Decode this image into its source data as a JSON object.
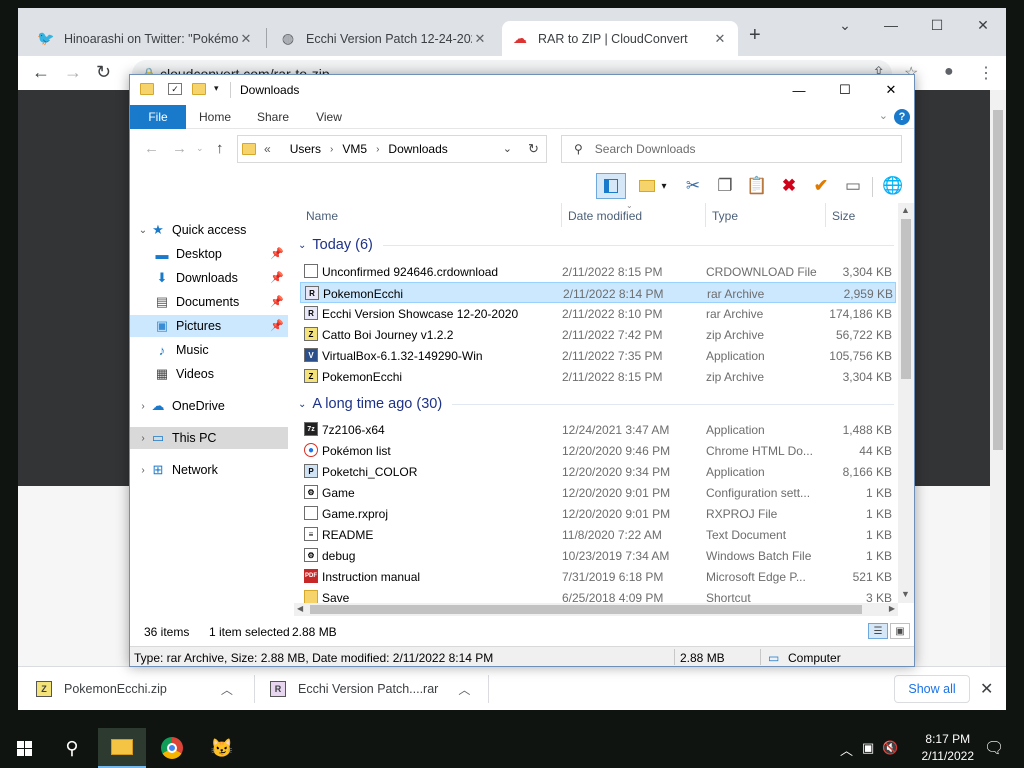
{
  "browser": {
    "tabs": [
      {
        "title": "Hinoarashi on Twitter: \"Pokémon",
        "favicon": "twitter-icon",
        "close": "✕"
      },
      {
        "title": "Ecchi Version Patch 12-24-2020",
        "favicon": "globe-icon",
        "close": "✕"
      },
      {
        "title": "RAR to ZIP | CloudConvert",
        "favicon": "cloudconvert-icon",
        "close": "✕"
      }
    ],
    "url": "cloudconvert.com/rar-to-zip",
    "downloads": [
      {
        "name": "PokemonEcchi.zip",
        "badge": "Z"
      },
      {
        "name": "Ecchi Version Patch....rar",
        "badge": "R"
      }
    ],
    "show_all": "Show all"
  },
  "explorer": {
    "title": "Downloads",
    "ribbon_tabs": [
      "File",
      "Home",
      "Share",
      "View"
    ],
    "breadcrumb": [
      "«",
      "Users",
      "VM5",
      "Downloads"
    ],
    "search_placeholder": "Search Downloads",
    "nav": [
      {
        "label": "Quick access",
        "icon": "star-icon",
        "pinned": false
      },
      {
        "label": "Desktop",
        "icon": "desktop-icon",
        "pinned": true
      },
      {
        "label": "Downloads",
        "icon": "download-arrow-icon",
        "pinned": true
      },
      {
        "label": "Documents",
        "icon": "document-icon",
        "pinned": true
      },
      {
        "label": "Pictures",
        "icon": "pictures-icon",
        "pinned": true
      },
      {
        "label": "Music",
        "icon": "music-note-icon",
        "pinned": false
      },
      {
        "label": "Videos",
        "icon": "video-icon",
        "pinned": false
      },
      {
        "label": "OneDrive",
        "icon": "cloud-icon",
        "pinned": false
      },
      {
        "label": "This PC",
        "icon": "computer-icon",
        "pinned": false
      },
      {
        "label": "Network",
        "icon": "network-icon",
        "pinned": false
      }
    ],
    "columns": [
      "Name",
      "Date modified",
      "Type",
      "Size"
    ],
    "groups": [
      {
        "label": "Today (6)",
        "rows": [
          {
            "name": "Unconfirmed 924646.crdownload",
            "date": "2/11/2022 8:15 PM",
            "type": "CRDOWNLOAD File",
            "size": "3,304 KB",
            "badge": ""
          },
          {
            "name": "PokemonEcchi",
            "date": "2/11/2022 8:14 PM",
            "type": "rar Archive",
            "size": "2,959 KB",
            "badge": "R"
          },
          {
            "name": "Ecchi Version Showcase 12-20-2020",
            "date": "2/11/2022 8:10 PM",
            "type": "rar Archive",
            "size": "174,186 KB",
            "badge": "R"
          },
          {
            "name": "Catto Boi Journey v1.2.2",
            "date": "2/11/2022 7:42 PM",
            "type": "zip Archive",
            "size": "56,722 KB",
            "badge": "Z"
          },
          {
            "name": "VirtualBox-6.1.32-149290-Win",
            "date": "2/11/2022 7:35 PM",
            "type": "Application",
            "size": "105,756 KB",
            "badge": "V"
          },
          {
            "name": "PokemonEcchi",
            "date": "2/11/2022 8:15 PM",
            "type": "zip Archive",
            "size": "3,304 KB",
            "badge": "Z"
          }
        ]
      },
      {
        "label": "A long time ago (30)",
        "rows": [
          {
            "name": "7z2106-x64",
            "date": "12/24/2021 3:47 AM",
            "type": "Application",
            "size": "1,488 KB",
            "badge": "7z"
          },
          {
            "name": "Pokémon list",
            "date": "12/20/2020 9:46 PM",
            "type": "Chrome HTML Do...",
            "size": "44 KB",
            "badge": "●"
          },
          {
            "name": "Poketchi_COLOR",
            "date": "12/20/2020 9:34 PM",
            "type": "Application",
            "size": "8,166 KB",
            "badge": "P"
          },
          {
            "name": "Game",
            "date": "12/20/2020 9:01 PM",
            "type": "Configuration sett...",
            "size": "1 KB",
            "badge": "⚙"
          },
          {
            "name": "Game.rxproj",
            "date": "12/20/2020 9:01 PM",
            "type": "RXPROJ File",
            "size": "1 KB",
            "badge": ""
          },
          {
            "name": "README",
            "date": "11/8/2020 7:22 AM",
            "type": "Text Document",
            "size": "1 KB",
            "badge": "≡"
          },
          {
            "name": "debug",
            "date": "10/23/2019 7:34 AM",
            "type": "Windows Batch File",
            "size": "1 KB",
            "badge": "⚙"
          },
          {
            "name": "Instruction manual",
            "date": "7/31/2019 6:18 PM",
            "type": "Microsoft Edge P...",
            "size": "521 KB",
            "badge": "PDF"
          },
          {
            "name": "Save",
            "date": "6/25/2018 4:09 PM",
            "type": "Shortcut",
            "size": "3 KB",
            "badge": ""
          }
        ]
      }
    ],
    "status": {
      "count": "36 items",
      "selected": "1 item selected",
      "selected_size": "2.88 MB"
    },
    "detail": {
      "info": "Type: rar Archive, Size: 2.88 MB, Date modified: 2/11/2022 8:14 PM",
      "size": "2.88 MB",
      "location": "Computer"
    }
  },
  "taskbar": {
    "time": "8:17 PM",
    "date": "2/11/2022"
  },
  "colors": {
    "accent": "#1979ca",
    "selection": "#cce8ff",
    "group_header": "#1e3287"
  }
}
